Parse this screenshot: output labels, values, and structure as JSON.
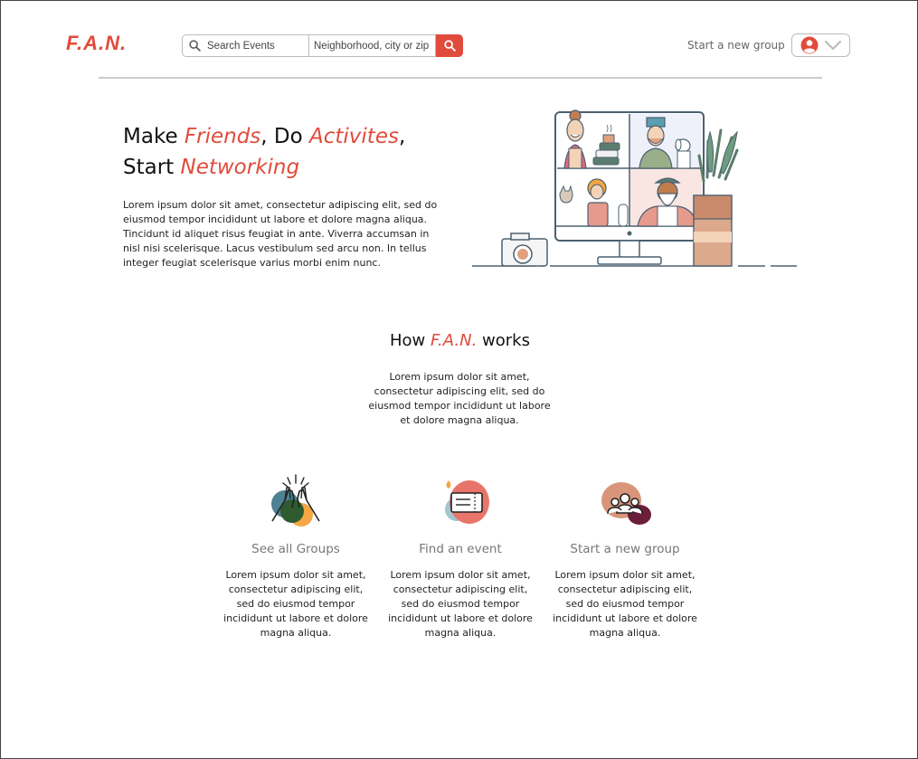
{
  "header": {
    "logo": "F.A.N.",
    "search_placeholder": "Search Events",
    "location_placeholder": "Neighborhood, city or zip",
    "start_group_link": "Start a new group"
  },
  "hero": {
    "title_line1_a": "Make ",
    "title_line1_b": "Friends",
    "title_line1_c": ", Do ",
    "title_line1_d": "Activites",
    "title_line1_e": ",",
    "title_line2_a": "Start ",
    "title_line2_b": "Networking",
    "body": "Lorem ipsum dolor sit amet, consectetur adipiscing elit, sed do eiusmod tempor incididunt ut labore et dolore magna aliqua. Tincidunt id aliquet risus feugiat in ante. Viverra accumsan in nisl nisi scelerisque. Lacus vestibulum sed arcu non. In tellus integer feugiat scelerisque varius morbi enim nunc."
  },
  "how": {
    "title_a": "How ",
    "title_b": "F.A.N.",
    "title_c": " works",
    "body": "Lorem ipsum dolor sit amet, consectetur adipiscing elit, sed do eiusmod tempor incididunt ut labore et dolore magna aliqua."
  },
  "features": [
    {
      "title": "See all Groups",
      "text": "Lorem ipsum dolor sit amet, consectetur adipiscing elit, sed do eiusmod tempor incididunt ut labore et dolore magna aliqua.",
      "icon": "high-five-icon"
    },
    {
      "title": "Find an event",
      "text": "Lorem ipsum dolor sit amet, consectetur adipiscing elit, sed do eiusmod tempor incididunt ut labore et dolore magna aliqua.",
      "icon": "ticket-icon"
    },
    {
      "title": "Start a new group",
      "text": "Lorem ipsum dolor sit amet, consectetur adipiscing elit, sed do eiusmod tempor incididunt ut labore et dolore magna aliqua.",
      "icon": "group-icon"
    }
  ],
  "colors": {
    "accent": "#e14b3b"
  }
}
